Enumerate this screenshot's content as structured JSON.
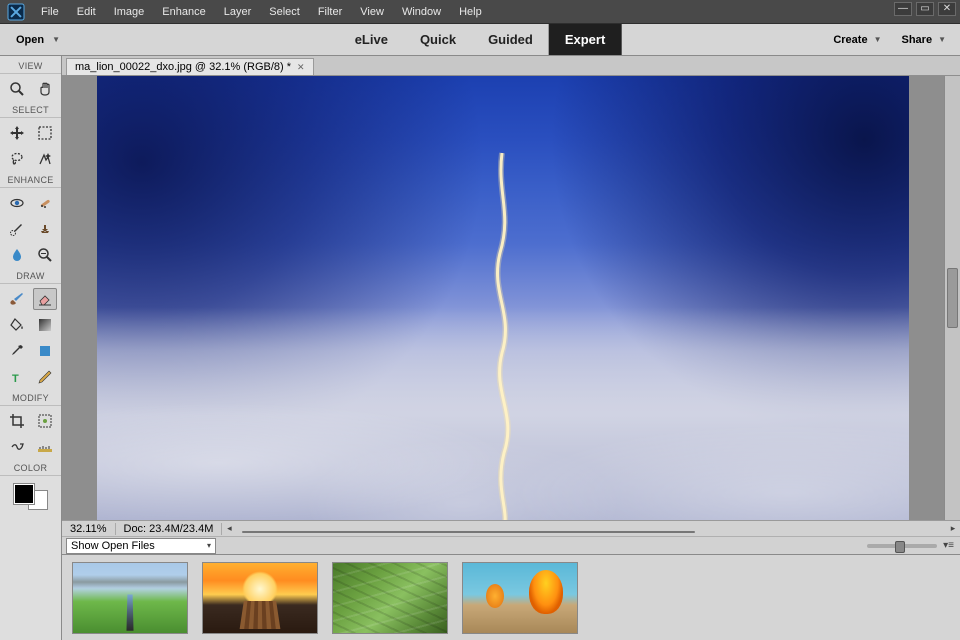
{
  "menubar": {
    "items": [
      "File",
      "Edit",
      "Image",
      "Enhance",
      "Layer",
      "Select",
      "Filter",
      "View",
      "Window",
      "Help"
    ]
  },
  "modebar": {
    "open_label": "Open",
    "tabs": [
      "eLive",
      "Quick",
      "Guided",
      "Expert"
    ],
    "active_tab": "Expert",
    "create_label": "Create",
    "share_label": "Share"
  },
  "toolpanel": {
    "sections": {
      "view": "VIEW",
      "select": "SELECT",
      "enhance": "ENHANCE",
      "draw": "DRAW",
      "modify": "MODIFY",
      "color": "COLOR"
    }
  },
  "document": {
    "tab_title": "ma_lion_00022_dxo.jpg @ 32.1% (RGB/8) *"
  },
  "status": {
    "zoom": "32.11%",
    "doc_info": "Doc: 23.4M/23.4M"
  },
  "openfiles": {
    "dropdown_label": "Show Open Files"
  }
}
